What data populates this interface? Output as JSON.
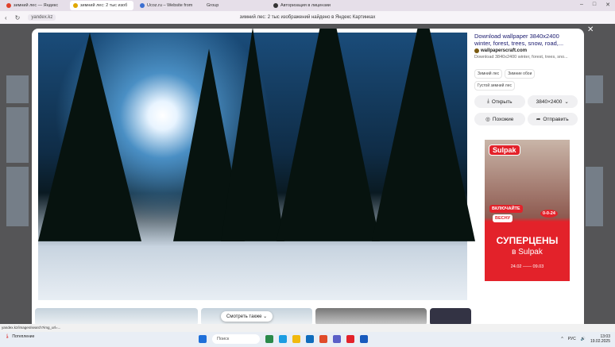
{
  "browser": {
    "tabs": [
      {
        "label": "зимний лес — Яндекс",
        "color": "#e0412b"
      },
      {
        "label": "зимний лес: 2 тыс изоб",
        "color": "#e0a800",
        "active": true
      },
      {
        "label": "Ucoz.ru – Website from",
        "color": "#3b6fd1"
      },
      {
        "label": "Group",
        "color": "#888888"
      },
      {
        "label": "Авторизация в лицензии",
        "color": "#333333"
      }
    ],
    "new_tab": "+",
    "url": "yandex.kz",
    "page_title": "зимний лес: 2 тыс изображений найдено в Яндекс Картинках"
  },
  "viewer": {
    "close": "✕",
    "source_title": "Download wallpaper 3840x2400 winter, forest, trees, snow, road,...",
    "source_site": "wallpaperscraft.com",
    "source_desc": "Download 3840x2400 winter, forest, trees, sno...",
    "chips": [
      "Зимний лес",
      "Зимние обои",
      "Густой зимний лес"
    ],
    "open_label": "Открыть",
    "size_label": "3840×2400",
    "similar_label": "Похожие",
    "share_label": "Отправить",
    "see_more": "Смотреть также"
  },
  "ad": {
    "brand": "Sulpak",
    "tag1": "ВКЛЮЧАЙТЕ",
    "tag2": "ВЕСНУ",
    "promo": "0-0-24",
    "headline": "СУПЕРЦЕНЫ",
    "sub": "в Sulpak",
    "date_from": "24.02",
    "date_to": "09.03",
    "brand_color": "#e3222a"
  },
  "status_url": "yandex.kz/images/search?img_url=...",
  "taskbar": {
    "weather": "Потепление",
    "search": "Поиск",
    "lang": "РУС",
    "time": "13:03",
    "date": "19.02.2025"
  }
}
